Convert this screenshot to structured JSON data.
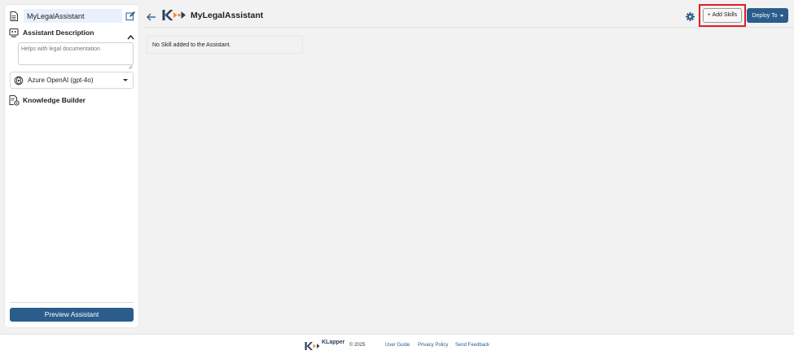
{
  "sidebar": {
    "assistant_name": "MyLegalAssistant",
    "description_title": "Assistant Description",
    "description_placeholder": "Helps with legal documentation",
    "model_selected": "Azure OpenAI (gpt-4o)",
    "knowledge_builder": "Knowledge Builder",
    "preview_button": "Preview Assistant"
  },
  "header": {
    "title": "MyLegalAssistant",
    "add_skills_button": "+ Add Skills",
    "deploy_button": "Deploy To"
  },
  "main": {
    "empty_message": "No Skill added to the Assistant."
  },
  "footer": {
    "brand": "KLapper",
    "copyright": "© 2025",
    "links": [
      "User Guide",
      "Privacy Policy",
      "Send Feedback"
    ]
  },
  "colors": {
    "primary": "#2b5d8c",
    "logo_dark": "#2b3f5c",
    "logo_accent": "#f28a2e",
    "highlight": "#e01e25"
  }
}
